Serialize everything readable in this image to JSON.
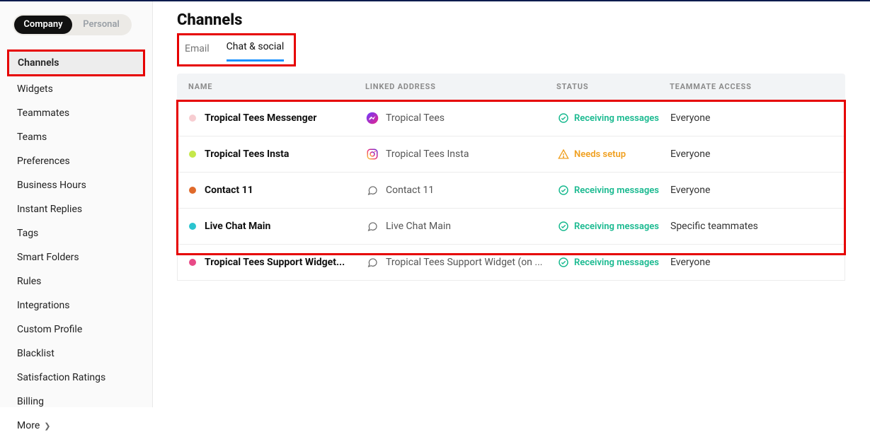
{
  "sidebar": {
    "toggle": {
      "company": "Company",
      "personal": "Personal"
    },
    "items": [
      {
        "label": "Channels"
      },
      {
        "label": "Widgets"
      },
      {
        "label": "Teammates"
      },
      {
        "label": "Teams"
      },
      {
        "label": "Preferences"
      },
      {
        "label": "Business Hours"
      },
      {
        "label": "Instant Replies"
      },
      {
        "label": "Tags"
      },
      {
        "label": "Smart Folders"
      },
      {
        "label": "Rules"
      },
      {
        "label": "Integrations"
      },
      {
        "label": "Custom Profile"
      },
      {
        "label": "Blacklist"
      },
      {
        "label": "Satisfaction Ratings"
      },
      {
        "label": "Billing"
      },
      {
        "label": "More"
      }
    ]
  },
  "page": {
    "title": "Channels"
  },
  "tabs": {
    "email": "Email",
    "chat": "Chat & social"
  },
  "table": {
    "headers": {
      "name": "NAME",
      "linked": "LINKED ADDRESS",
      "status": "STATUS",
      "access": "TEAMMATE ACCESS"
    },
    "rows": [
      {
        "dot": "#f7cdd1",
        "name": "Tropical Tees Messenger",
        "linked": "Tropical Tees",
        "icon": "messenger",
        "status": "Receiving messages",
        "status_kind": "ok",
        "access": "Everyone"
      },
      {
        "dot": "#c5e84a",
        "name": "Tropical Tees Insta",
        "linked": "Tropical Tees Insta",
        "icon": "instagram",
        "status": "Needs setup",
        "status_kind": "warn",
        "access": "Everyone"
      },
      {
        "dot": "#e06a2b",
        "name": "Contact 11",
        "linked": "Contact 11",
        "icon": "chat",
        "status": "Receiving messages",
        "status_kind": "ok",
        "access": "Everyone"
      },
      {
        "dot": "#2bc4cf",
        "name": "Live Chat Main",
        "linked": "Live Chat Main",
        "icon": "chat",
        "status": "Receiving messages",
        "status_kind": "ok",
        "access": "Specific teammates"
      },
      {
        "dot": "#e84a87",
        "name": "Tropical Tees Support Widget...",
        "linked": "Tropical Tees Support Widget (on ...",
        "icon": "chat",
        "status": "Receiving messages",
        "status_kind": "ok",
        "access": "Everyone"
      }
    ]
  }
}
